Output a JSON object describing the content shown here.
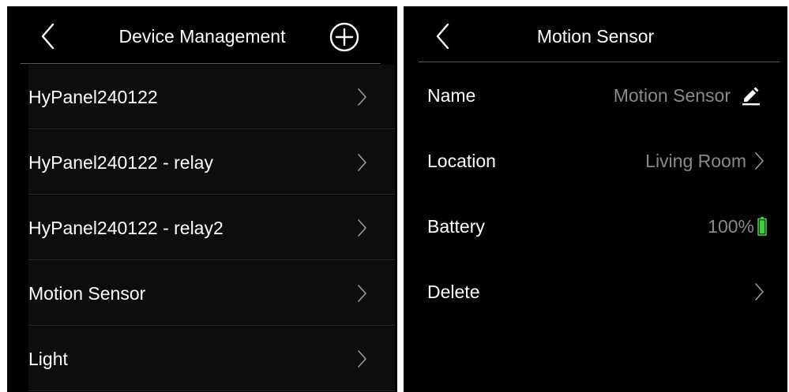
{
  "device_management": {
    "title": "Device Management",
    "back_icon": "chevron-left-icon",
    "add_icon": "plus-circle-icon",
    "devices": [
      {
        "label": "HyPanel240122"
      },
      {
        "label": "HyPanel240122 - relay"
      },
      {
        "label": "HyPanel240122 - relay2"
      },
      {
        "label": "Motion Sensor"
      },
      {
        "label": "Light"
      }
    ]
  },
  "device_detail": {
    "title": "Motion Sensor",
    "back_icon": "chevron-left-icon",
    "rows": {
      "name": {
        "label": "Name",
        "value": "Motion Sensor",
        "icon": "pencil-icon"
      },
      "location": {
        "label": "Location",
        "value": "Living Room",
        "icon": "chevron-right-icon"
      },
      "battery": {
        "label": "Battery",
        "value": "100%",
        "level": 1.0,
        "icon": "battery-icon",
        "color": "#3ad13a"
      },
      "delete": {
        "label": "Delete",
        "icon": "chevron-right-icon"
      }
    }
  },
  "colors": {
    "background": "#000000",
    "text": "#ffffff",
    "secondary_text": "#8a8a8a",
    "battery_green": "#3ad13a"
  }
}
